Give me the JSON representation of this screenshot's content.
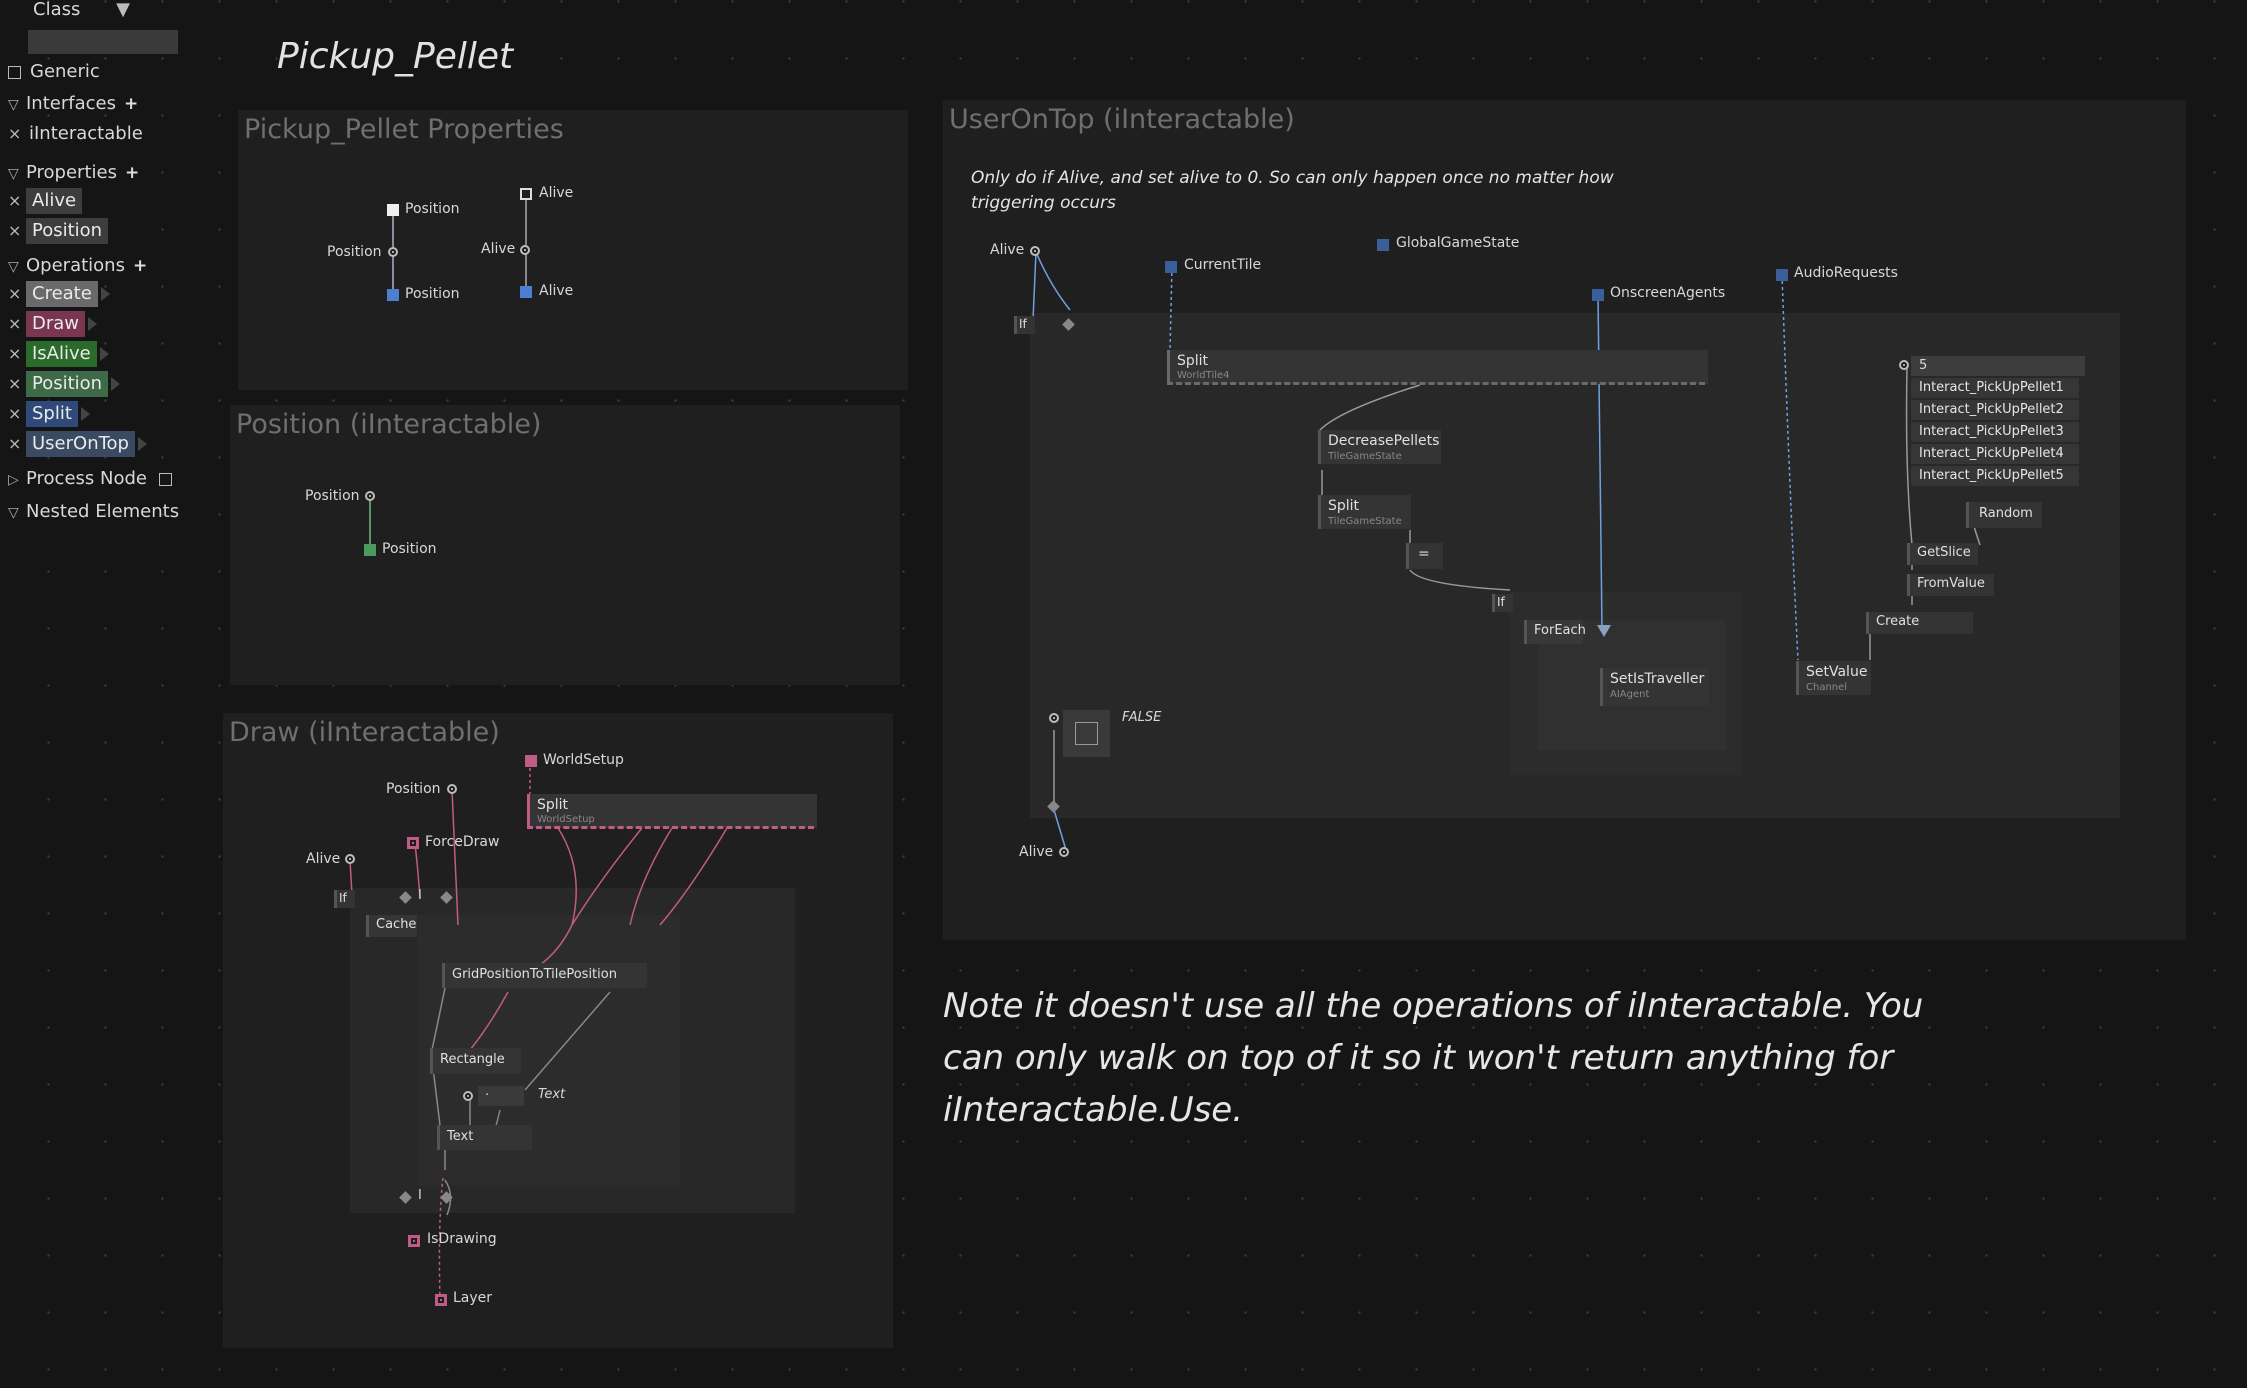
{
  "sidebar": {
    "class_label": "Class",
    "search_value": "",
    "generic_label": "Generic",
    "interfaces_label": "Interfaces",
    "interfaces": [
      "iInteractable"
    ],
    "properties_label": "Properties",
    "properties": [
      {
        "label": "Alive",
        "color": "#3d3d3d"
      },
      {
        "label": "Position",
        "color": "#3d3d3d"
      }
    ],
    "operations_label": "Operations",
    "operations": [
      {
        "label": "Create",
        "color": "#6a6a6a"
      },
      {
        "label": "Draw",
        "color": "#7a3550"
      },
      {
        "label": "IsAlive",
        "color": "#2a6a2a"
      },
      {
        "label": "Position",
        "color": "#3e6a48"
      },
      {
        "label": "Split",
        "color": "#2f4a78"
      },
      {
        "label": "UserOnTop",
        "color": "#3a4a62"
      }
    ],
    "process_node_label": "Process Node",
    "nested_elements_label": "Nested Elements"
  },
  "page_title": "Pickup_Pellet",
  "properties_panel": {
    "title": "Pickup_Pellet Properties",
    "position_out": "Position",
    "position_in": "Position",
    "position_value": "Position",
    "alive_out": "Alive",
    "alive_in": "Alive",
    "alive_value": "Alive"
  },
  "position_panel": {
    "title": "Position (iInteractable)",
    "input": "Position",
    "output": "Position"
  },
  "draw_panel": {
    "title": "Draw (iInteractable)",
    "world_setup": "WorldSetup",
    "position": "Position",
    "split": "Split",
    "split_sub": "WorldSetup",
    "force_draw": "ForceDraw",
    "alive": "Alive",
    "if": "If",
    "bar1": "I",
    "cache": "Cache",
    "grid_node": "GridPositionToTilePosition",
    "rectangle": "Rectangle",
    "dot": "·",
    "text_italic": "Text",
    "text_node": "Text",
    "bar2": "I",
    "is_drawing": "IsDrawing",
    "layer": "Layer"
  },
  "user_panel": {
    "title": "UserOnTop (iInteractable)",
    "comment": "Only do if Alive, and set alive to 0. So can only happen once no matter how triggering occurs",
    "alive_in": "Alive",
    "current_tile": "CurrentTile",
    "global_game_state": "GlobalGameState",
    "onscreen_agents": "OnscreenAgents",
    "audio_requests": "AudioRequests",
    "if1": "If",
    "split1": "Split",
    "split1_sub": "WorldTile4",
    "decrease": "DecreasePellets",
    "decrease_sub": "TileGameState",
    "split2": "Split",
    "split2_sub": "TileGameState",
    "eq": "=",
    "if2": "If",
    "foreach": "ForEach",
    "set_traveller": "SetIsTraveller",
    "set_traveller_sub": "AIAgent",
    "list_count": "5",
    "list_items": [
      "Interact_PickUpPellet1",
      "Interact_PickUpPellet2",
      "Interact_PickUpPellet3",
      "Interact_PickUpPellet4",
      "Interact_PickUpPellet5"
    ],
    "random": "Random",
    "get_slice": "GetSlice",
    "from_value": "FromValue",
    "create": "Create",
    "set_value": "SetValue",
    "set_value_sub": "Channel",
    "false_label": "FALSE",
    "alive_out": "Alive"
  },
  "note": "Note it doesn't use all the operations of iInteractable. You can only walk on top of it so it won't return anything for iInteractable.Use."
}
